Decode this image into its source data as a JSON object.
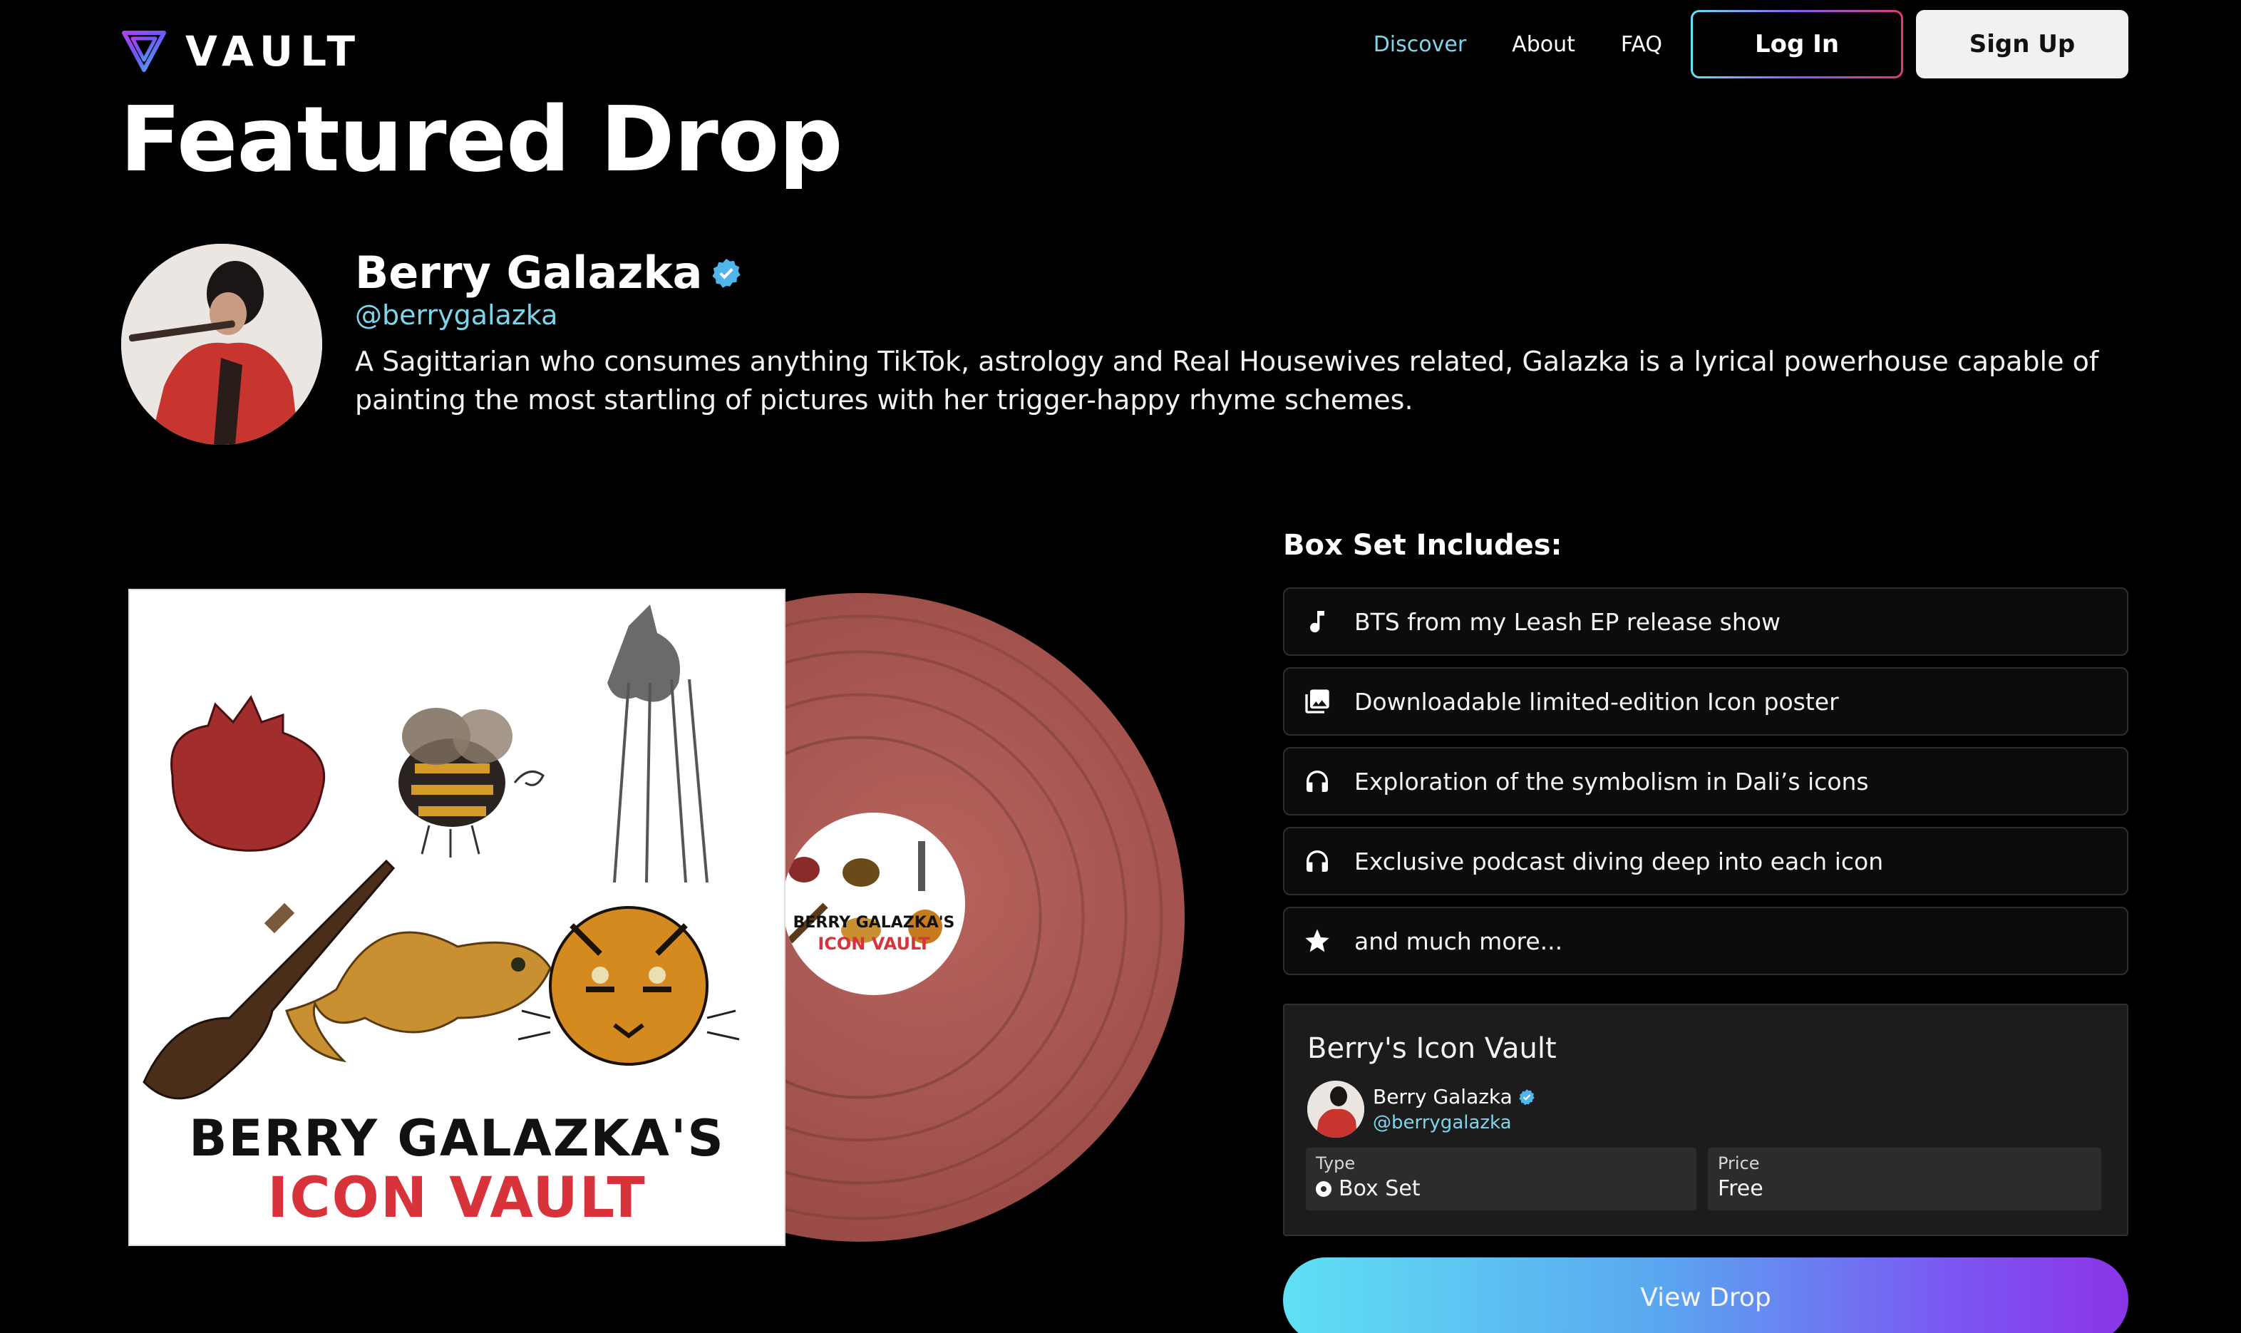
{
  "header": {
    "logo_text": "VAULT",
    "nav": [
      "Discover",
      "About",
      "FAQ"
    ],
    "login_label": "Log In",
    "signup_label": "Sign Up"
  },
  "page_title": "Featured Drop",
  "artist": {
    "name": "Berry Galazka",
    "handle": "@berrygalazka",
    "bio": "A Sagittarian who consumes anything TikTok, astrology and Real Housewives related, Galazka is a lyrical powerhouse capable of painting the most startling of pictures with her trigger-happy rhyme schemes."
  },
  "artwork": {
    "cover_line1": "BERRY GALAZKA'S",
    "cover_line2": "ICON VAULT"
  },
  "boxset": {
    "title": "Box Set Includes:",
    "items": [
      {
        "icon": "music-note-icon",
        "label": "BTS from my Leash EP release show"
      },
      {
        "icon": "image-gallery-icon",
        "label": "Downloadable limited-edition Icon poster"
      },
      {
        "icon": "headphones-icon",
        "label": "Exploration of the symbolism in Dali’s icons"
      },
      {
        "icon": "headphones-icon",
        "label": "Exclusive podcast diving deep into each icon"
      },
      {
        "icon": "star-icon",
        "label": "and much more..."
      }
    ]
  },
  "vault_card": {
    "name": "Berry's Icon Vault",
    "artist": "Berry Galazka",
    "handle": "@berrygalazka",
    "type_label": "Type",
    "type_value": "Box Set",
    "price_label": "Price",
    "price_value": "Free"
  },
  "cta_label": "View Drop",
  "colors": {
    "accent_cyan": "#7fd4ea",
    "vinyl": "#9a4b47",
    "cta_gradient": [
      "#5fe0f4",
      "#8b34e8"
    ]
  }
}
